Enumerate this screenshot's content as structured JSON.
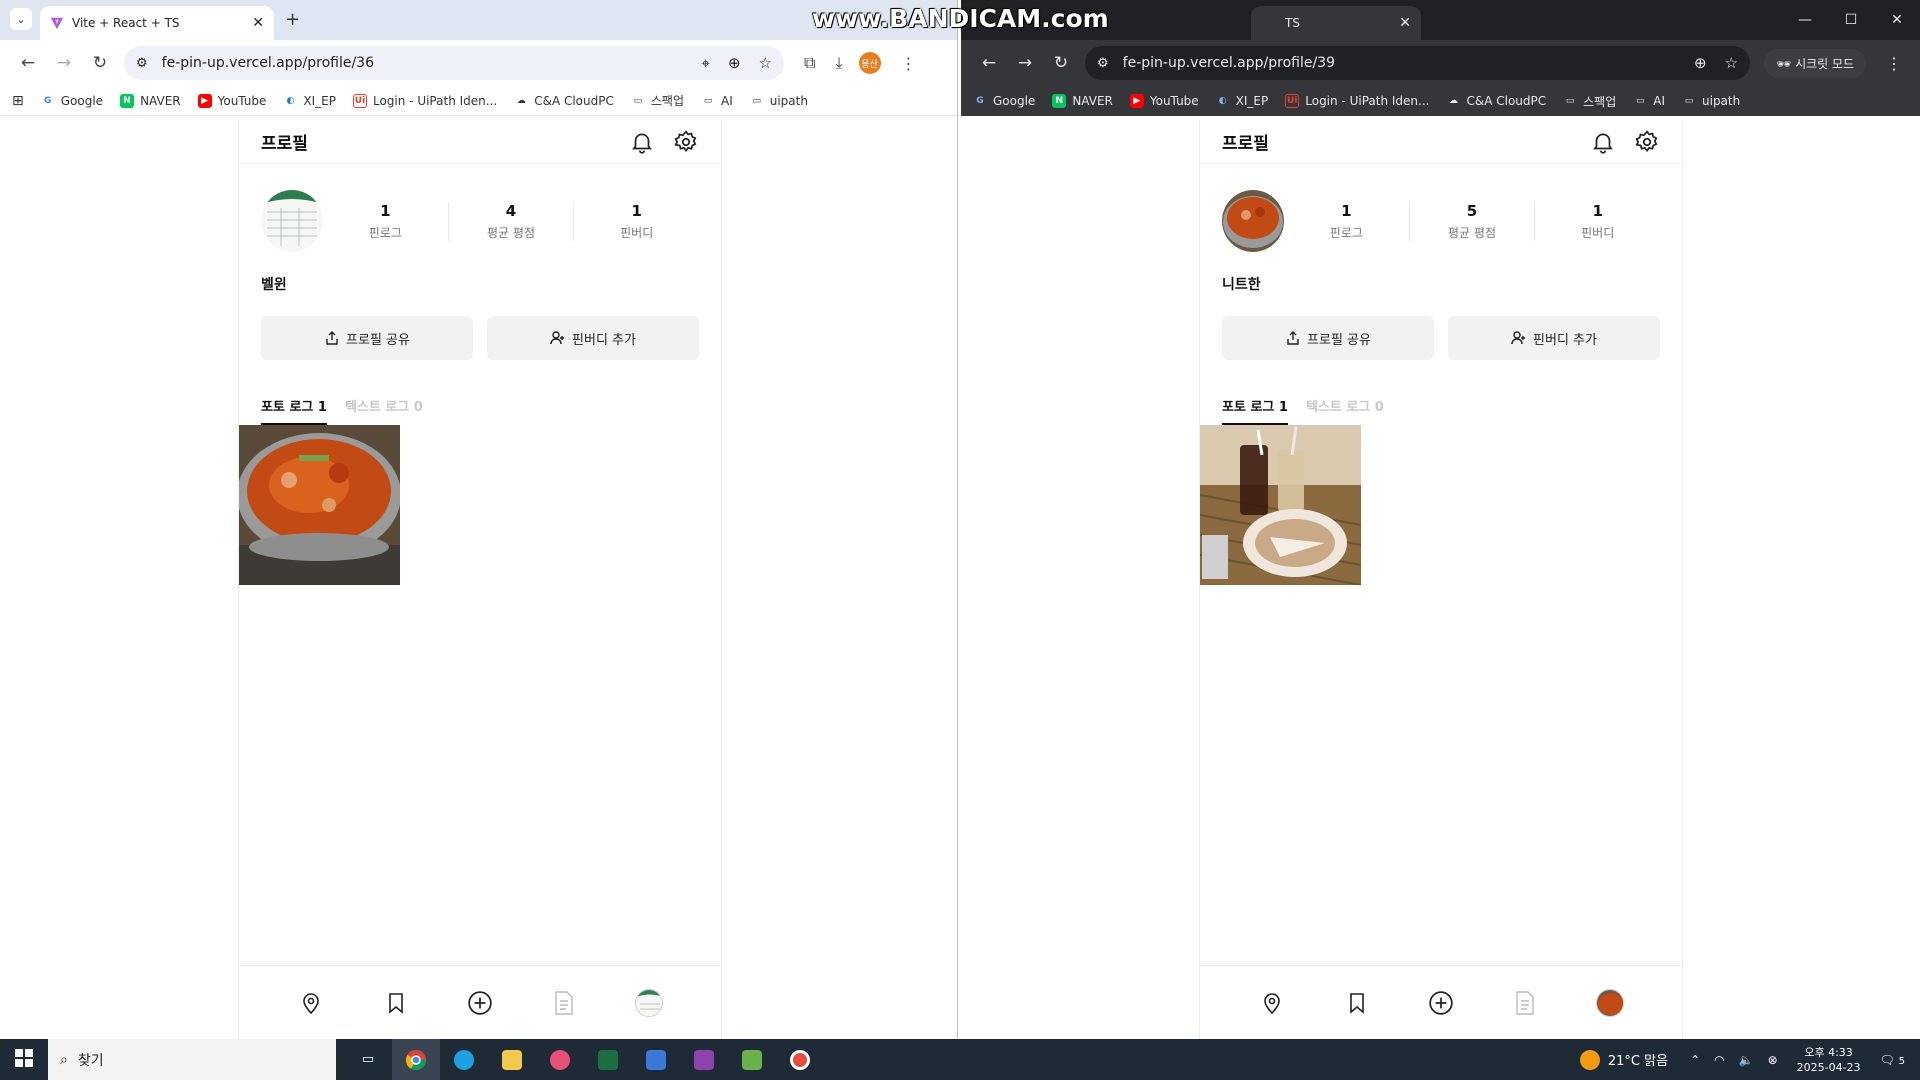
{
  "watermark": "www.BANDICAM.com",
  "left": {
    "tab_title": "Vite + React + TS",
    "url": "fe-pin-up.vercel.app/profile/36",
    "profile_badge": "용산"
  },
  "right": {
    "tab_title": "TS",
    "url": "fe-pin-up.vercel.app/profile/39",
    "incognito_label": "시크릿 모드"
  },
  "bookmarks": [
    "Google",
    "NAVER",
    "YouTube",
    "XI_EP",
    "Login - UiPath Iden...",
    "C&A CloudPC",
    "스팩업",
    "AI",
    "uipath"
  ],
  "profile_left": {
    "title": "프로필",
    "stats": [
      {
        "num": "1",
        "label": "핀로그"
      },
      {
        "num": "4",
        "label": "평균 평점"
      },
      {
        "num": "1",
        "label": "핀버디"
      }
    ],
    "nickname": "벨윈",
    "share_label": "프로필 공유",
    "add_buddy_label": "핀버디 추가",
    "tab_photo": "포토 로그 1",
    "tab_text": "텍스트 로그 0"
  },
  "profile_right": {
    "title": "프로필",
    "stats": [
      {
        "num": "1",
        "label": "핀로그"
      },
      {
        "num": "5",
        "label": "평균 평점"
      },
      {
        "num": "1",
        "label": "핀버디"
      }
    ],
    "nickname": "니트한",
    "share_label": "프로필 공유",
    "add_buddy_label": "핀버디 추가",
    "tab_photo": "포토 로그 1",
    "tab_text": "텍스트 로그 0"
  },
  "taskbar": {
    "search_placeholder": "찾기",
    "weather": "21°C 맑음",
    "time": "오후 4:33",
    "date": "2025-04-23",
    "notification_count": "5"
  }
}
